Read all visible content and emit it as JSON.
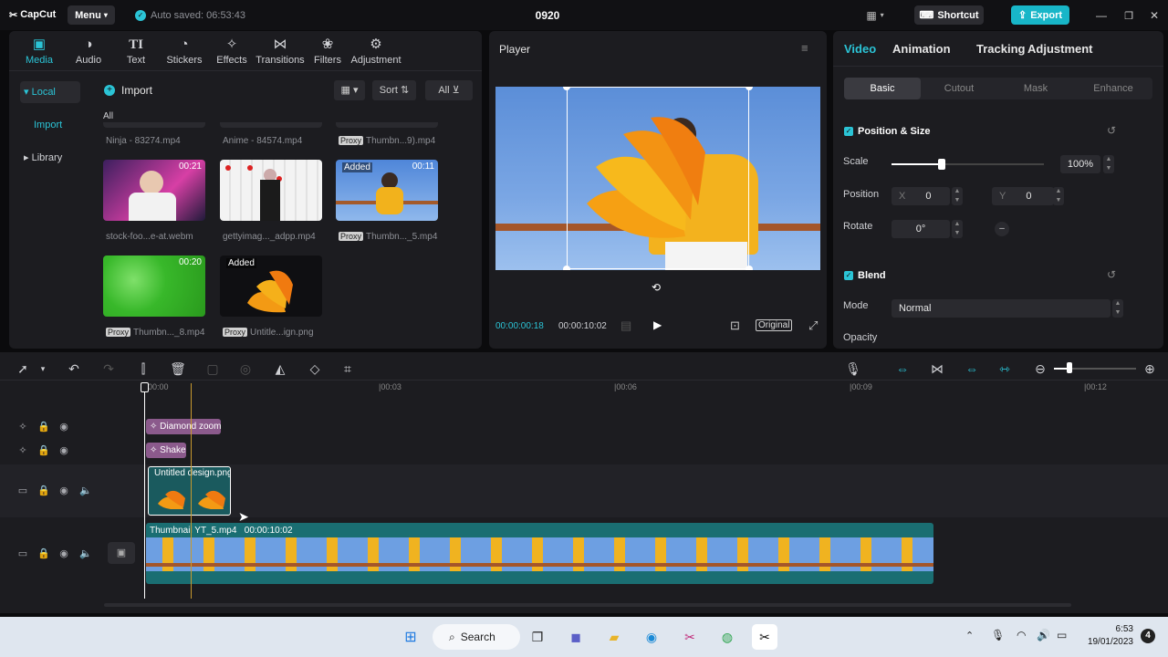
{
  "app": {
    "logo": "CapCut",
    "menu_label": "Menu",
    "autosave": "Auto saved: 06:53:43",
    "project_name": "0920",
    "shortcut_label": "Shortcut",
    "export_label": "Export"
  },
  "toolbar": {
    "items": [
      {
        "label": "Media",
        "icon": "media-icon"
      },
      {
        "label": "Audio",
        "icon": "audio-icon"
      },
      {
        "label": "Text",
        "icon": "text-icon"
      },
      {
        "label": "Stickers",
        "icon": "stickers-icon"
      },
      {
        "label": "Effects",
        "icon": "effects-icon"
      },
      {
        "label": "Transitions",
        "icon": "transitions-icon"
      },
      {
        "label": "Filters",
        "icon": "filters-icon"
      },
      {
        "label": "Adjustment",
        "icon": "adjustment-icon"
      }
    ]
  },
  "media": {
    "sidebar": [
      "Local",
      "Import",
      "Library"
    ],
    "import_label": "Import",
    "sort_label": "Sort",
    "filter_label": "All",
    "section_label": "All",
    "top_row": [
      "Ninja - 83274.mp4",
      "Anime - 84574.mp4",
      "Thumbn...9).mp4"
    ],
    "items": [
      {
        "name": "stock-foo...e-at.webm",
        "duration": "00:21",
        "proxy": false,
        "added": false
      },
      {
        "name": "gettyimag..._adpp.mp4",
        "duration": "",
        "proxy": false,
        "added": false
      },
      {
        "name": "Thumbn..._5.mp4",
        "duration": "00:11",
        "proxy": true,
        "added": true
      },
      {
        "name": "Thumbn..._8.mp4",
        "duration": "00:20",
        "proxy": true,
        "added": false
      },
      {
        "name": "Untitle...ign.png",
        "duration": "",
        "proxy": true,
        "added": true
      }
    ],
    "proxy_badge": "Proxy",
    "added_badge": "Added"
  },
  "player": {
    "title": "Player",
    "current_time": "00:00:00:18",
    "total_time": "00:00:10:02",
    "original_label": "Original"
  },
  "inspector": {
    "tabs": [
      "Video",
      "Animation",
      "Tracking",
      "Adjustment"
    ],
    "subtabs": [
      "Basic",
      "Cutout",
      "Mask",
      "Enhance"
    ],
    "position_size": {
      "title": "Position & Size",
      "scale_label": "Scale",
      "scale_value": "100%",
      "scale_fraction": 0.33,
      "position_label": "Position",
      "x_label": "X",
      "x_value": "0",
      "y_label": "Y",
      "y_value": "0",
      "rotate_label": "Rotate",
      "rotate_value": "0°"
    },
    "blend": {
      "title": "Blend",
      "mode_label": "Mode",
      "mode_value": "Normal",
      "opacity_label": "Opacity"
    }
  },
  "timeline": {
    "ruler": [
      "00:00",
      "|00:03",
      "|00:06",
      "|00:09",
      "|00:12"
    ],
    "effect_clips": [
      "Diamond zoom",
      "Shake"
    ],
    "overlay_clip": "Untitled design.png",
    "main_clip": {
      "name": "Thumbnail YT_5.mp4",
      "duration": "00:00:10:02"
    }
  },
  "taskbar": {
    "search_label": "Search",
    "time": "6:53",
    "date": "19/01/2023"
  },
  "colors": {
    "accent": "#2bc4d6",
    "effect_clip": "#8b5a8c",
    "main_track": "#1a6e72",
    "export_btn": "#18b6c8"
  }
}
